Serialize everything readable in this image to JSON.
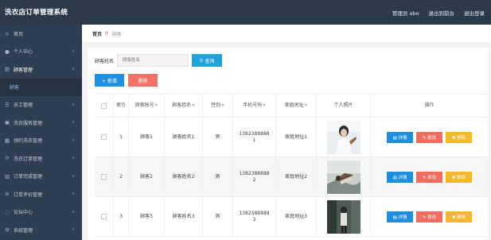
{
  "app": {
    "title": "洗衣店订单管理系统",
    "user_label": "管理员 abo",
    "link_home": "退出到前台",
    "link_logout": "退出登录"
  },
  "sidebar": {
    "items": [
      {
        "label": "首页",
        "icon": "home-icon"
      },
      {
        "label": "个人中心",
        "icon": "user-icon"
      },
      {
        "label": "顾客管理",
        "icon": "users-icon",
        "expanded": true,
        "sub": "顾客"
      },
      {
        "label": "员工管理",
        "icon": "staff-icon"
      },
      {
        "label": "洗衣服务管理",
        "icon": "wash-icon"
      },
      {
        "label": "预约洗衣管理",
        "icon": "calendar-icon"
      },
      {
        "label": "洗衣订单管理",
        "icon": "order-icon"
      },
      {
        "label": "订单完成管理",
        "icon": "done-icon"
      },
      {
        "label": "订单评价管理",
        "icon": "star-icon"
      },
      {
        "label": "论坛中心",
        "icon": "forum-icon"
      },
      {
        "label": "系统管理",
        "icon": "settings-icon"
      }
    ]
  },
  "breadcrumb": {
    "home": "首页",
    "current": "顾客"
  },
  "search": {
    "label": "顾客姓名",
    "placeholder": "顾客姓名",
    "button": "查询"
  },
  "actions": {
    "add": "+ 新增",
    "delete": "删除"
  },
  "table": {
    "headers": {
      "index": "索引",
      "account": "顾客账号",
      "name": "顾客姓名",
      "gender": "性别",
      "phone": "手机号码",
      "address": "家庭地址",
      "photo": "个人照片",
      "ops": "操作"
    },
    "op_labels": {
      "detail": "详情",
      "edit": "修改",
      "remove": "删除"
    },
    "rows": [
      {
        "index": "1",
        "account": "顾客1",
        "name": "顾客姓名1",
        "gender": "男",
        "phone": "13823888881",
        "address": "家庭地址1",
        "photo": "portrait-white-dress"
      },
      {
        "index": "2",
        "account": "顾客2",
        "name": "顾客姓名2",
        "gender": "男",
        "phone": "13823888882",
        "address": "家庭地址2",
        "photo": "portrait-outdoor"
      },
      {
        "index": "3",
        "account": "顾客3",
        "name": "顾客姓名3",
        "gender": "男",
        "phone": "13823888883",
        "address": "家庭地址3",
        "photo": "portrait-street"
      }
    ]
  },
  "colors": {
    "topbar": "#2d3a4b",
    "sidebar": "#2f3e50",
    "primary": "#2390df",
    "danger": "#ef7466",
    "warning": "#f2b72e"
  }
}
